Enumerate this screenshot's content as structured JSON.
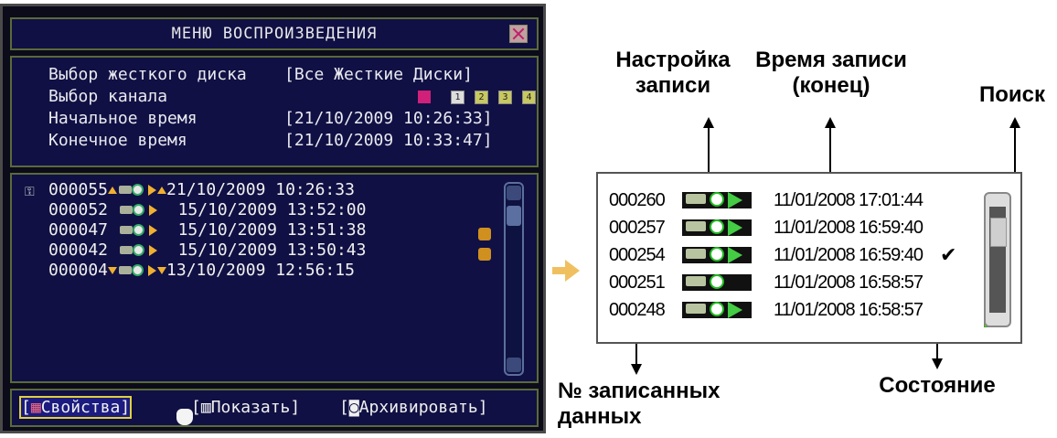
{
  "dvr": {
    "title": "МЕНЮ ВОСПРОИЗВЕДЕНИЯ",
    "settings": {
      "hdd_label": "Выбор жесткого диска",
      "hdd_value": "[Все Жесткие Диски]",
      "channel_label": "Выбор канала",
      "channels": [
        "1",
        "2",
        "3",
        "4"
      ],
      "start_label": "Начальное время",
      "start_value": "[21/10/2009 10:26:33]",
      "end_label": "Конечное время",
      "end_value": "[21/10/2009 10:33:47]"
    },
    "records": [
      {
        "id": "000055",
        "datetime": "21/10/2009 10:26:33"
      },
      {
        "id": "000052",
        "datetime": "15/10/2009 13:52:00"
      },
      {
        "id": "000047",
        "datetime": "15/10/2009 13:51:38"
      },
      {
        "id": "000042",
        "datetime": "15/10/2009 13:50:43"
      },
      {
        "id": "000004",
        "datetime": "13/10/2009 12:56:15"
      }
    ],
    "buttons": {
      "properties": "Свойства",
      "show": "Показать",
      "archive": "Архивировать"
    }
  },
  "callout": {
    "labels": {
      "record_settings_1": "Настройка",
      "record_settings_2": "записи",
      "record_time_1": "Время записи",
      "record_time_2": "(конец)",
      "search": "Поиск",
      "data_no_1": "№ записанных",
      "data_no_2": "данных",
      "status": "Состояние"
    },
    "rows": [
      {
        "id": "000260",
        "datetime": "11/01/2008  17:01:44"
      },
      {
        "id": "000257",
        "datetime": "11/01/2008  16:59:40"
      },
      {
        "id": "000254",
        "datetime": "11/01/2008  16:59:40"
      },
      {
        "id": "000251",
        "datetime": "11/01/2008  16:58:57"
      },
      {
        "id": "000248",
        "datetime": "11/01/2008  16:58:57"
      }
    ],
    "check_mark": "✔"
  }
}
